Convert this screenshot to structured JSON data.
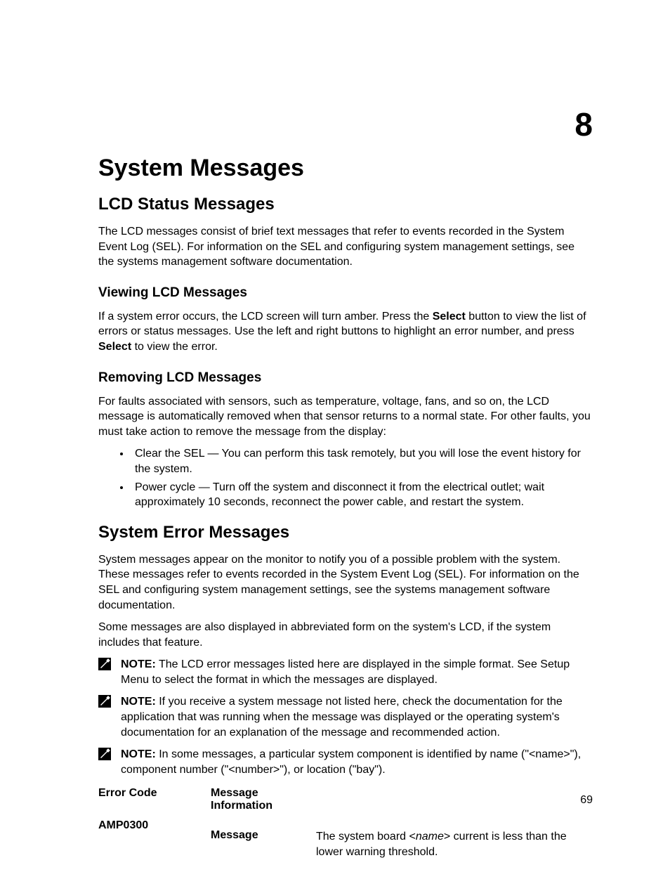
{
  "chapter_number": "8",
  "title": "System Messages",
  "section1": {
    "heading": "LCD Status Messages",
    "intro": "The LCD messages consist of brief text messages that refer to events recorded in the System Event Log (SEL). For information on the SEL and configuring system management settings, see the systems management software documentation.",
    "sub1": {
      "heading": "Viewing LCD Messages",
      "p_pre": "If a system error occurs, the LCD screen will turn amber. Press the ",
      "p_bold1": "Select",
      "p_mid": " button to view the list of errors or status messages. Use the left and right buttons to highlight an error number, and press ",
      "p_bold2": "Select",
      "p_post": " to view the error."
    },
    "sub2": {
      "heading": "Removing LCD Messages",
      "intro": "For faults associated with sensors, such as temperature, voltage, fans, and so on, the LCD message is automatically removed when that sensor returns to a normal state. For other faults, you must take action to remove the message from the display:",
      "bullets": [
        "Clear the SEL — You can perform this task remotely, but you will lose the event history for the system.",
        "Power cycle — Turn off the system and disconnect it from the electrical outlet; wait approximately 10 seconds, reconnect the power cable, and restart the system."
      ]
    }
  },
  "section2": {
    "heading": "System Error Messages",
    "p1": "System messages appear on the monitor to notify you of a possible problem with the system. These messages refer to events recorded in the System Event Log (SEL). For information on the SEL and configuring system management settings, see the systems management software documentation.",
    "p2": "Some messages are also displayed in abbreviated form on the system's LCD, if the system includes that feature.",
    "notes": [
      {
        "label": "NOTE:",
        "text": " The LCD error messages listed here are displayed in the simple format. See Setup Menu to select the format in which the messages are displayed."
      },
      {
        "label": "NOTE:",
        "text": " If you receive a system message not listed here, check the documentation for the application that was running when the message was displayed or the operating system's documentation for an explanation of the message and recommended action."
      },
      {
        "label": "NOTE:",
        "text": " In some messages, a particular system component is identified by name (\"<name>\"), component number (\"<number>\"), or location (\"bay\")."
      }
    ],
    "table": {
      "header": {
        "c1": "Error Code",
        "c2": "Message Information"
      },
      "rows": [
        {
          "code": "AMP0300",
          "label": "Message",
          "msg_pre": "The system board <",
          "msg_italic": "name",
          "msg_post": "> current is less than the lower warning threshold."
        }
      ]
    }
  },
  "page_number": "69"
}
